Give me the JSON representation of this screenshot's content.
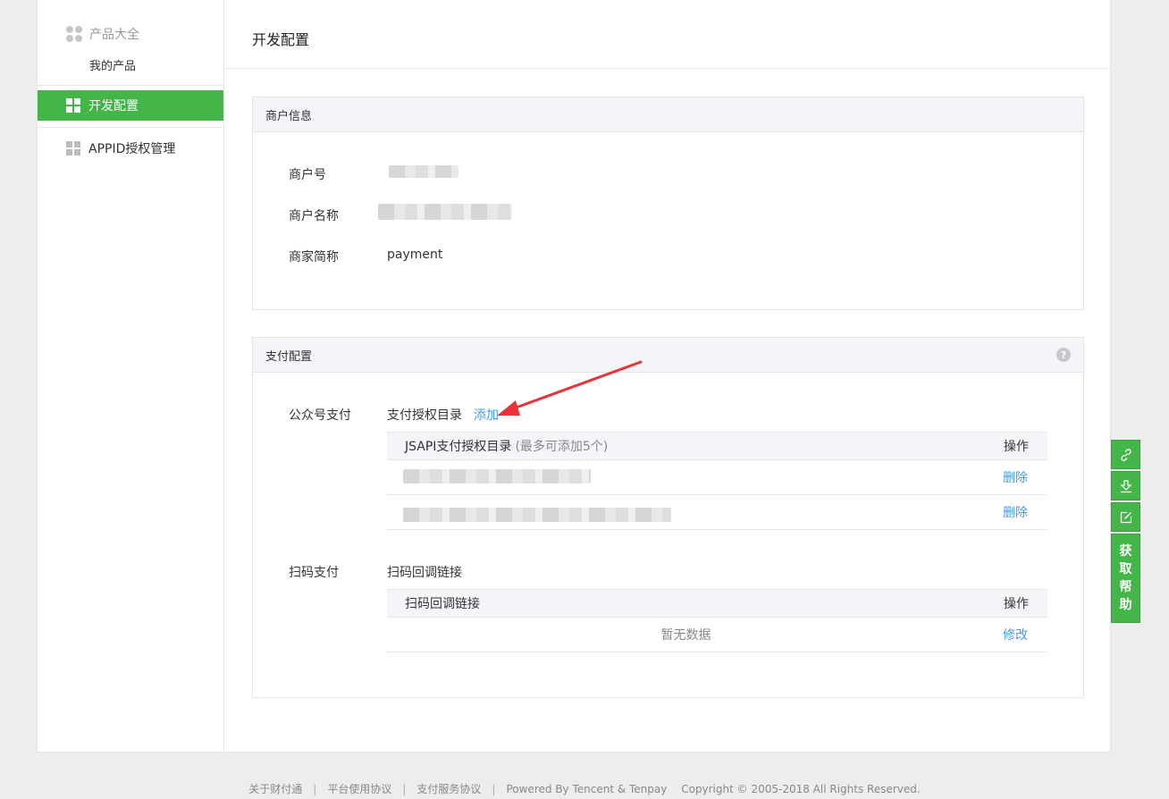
{
  "sidebar": {
    "category": "产品大全",
    "sub_item": "我的产品",
    "items": [
      {
        "label": "开发配置",
        "active": true
      },
      {
        "label": "APPID授权管理",
        "active": false
      }
    ]
  },
  "page": {
    "title": "开发配置"
  },
  "merchant": {
    "header": "商户信息",
    "rows": [
      {
        "label": "商户号",
        "value": ""
      },
      {
        "label": "商户名称",
        "value": ""
      },
      {
        "label": "商家简称",
        "value": "payment"
      }
    ]
  },
  "payment": {
    "header": "支付配置",
    "help_icon": "?",
    "mp": {
      "label": "公众号支付",
      "title": "支付授权目录",
      "add_label": "添加",
      "table": {
        "col_main": "JSAPI支付授权目录",
        "col_note": "(最多可添加5个)",
        "col_op": "操作",
        "rows": [
          {
            "value": "",
            "op": "删除"
          },
          {
            "value": "",
            "op": "删除"
          }
        ]
      }
    },
    "scan": {
      "label": "扫码支付",
      "title": "扫码回调链接",
      "table": {
        "col_main": "扫码回调链接",
        "col_op": "操作",
        "empty": "暂无数据",
        "op": "修改"
      }
    }
  },
  "float_bar": {
    "icons": [
      "link-icon",
      "download-icon",
      "edit-icon"
    ],
    "help_chars": [
      "获",
      "取",
      "帮",
      "助"
    ]
  },
  "footer": {
    "links": [
      "关于财付通",
      "平台使用协议",
      "支付服务协议"
    ],
    "powered": "Powered By Tencent & Tenpay",
    "copyright": "Copyright © 2005-2018 All Rights Reserved."
  },
  "colors": {
    "accent": "#44b549",
    "link": "#459ae9",
    "annotation_arrow": "#e8333a"
  }
}
